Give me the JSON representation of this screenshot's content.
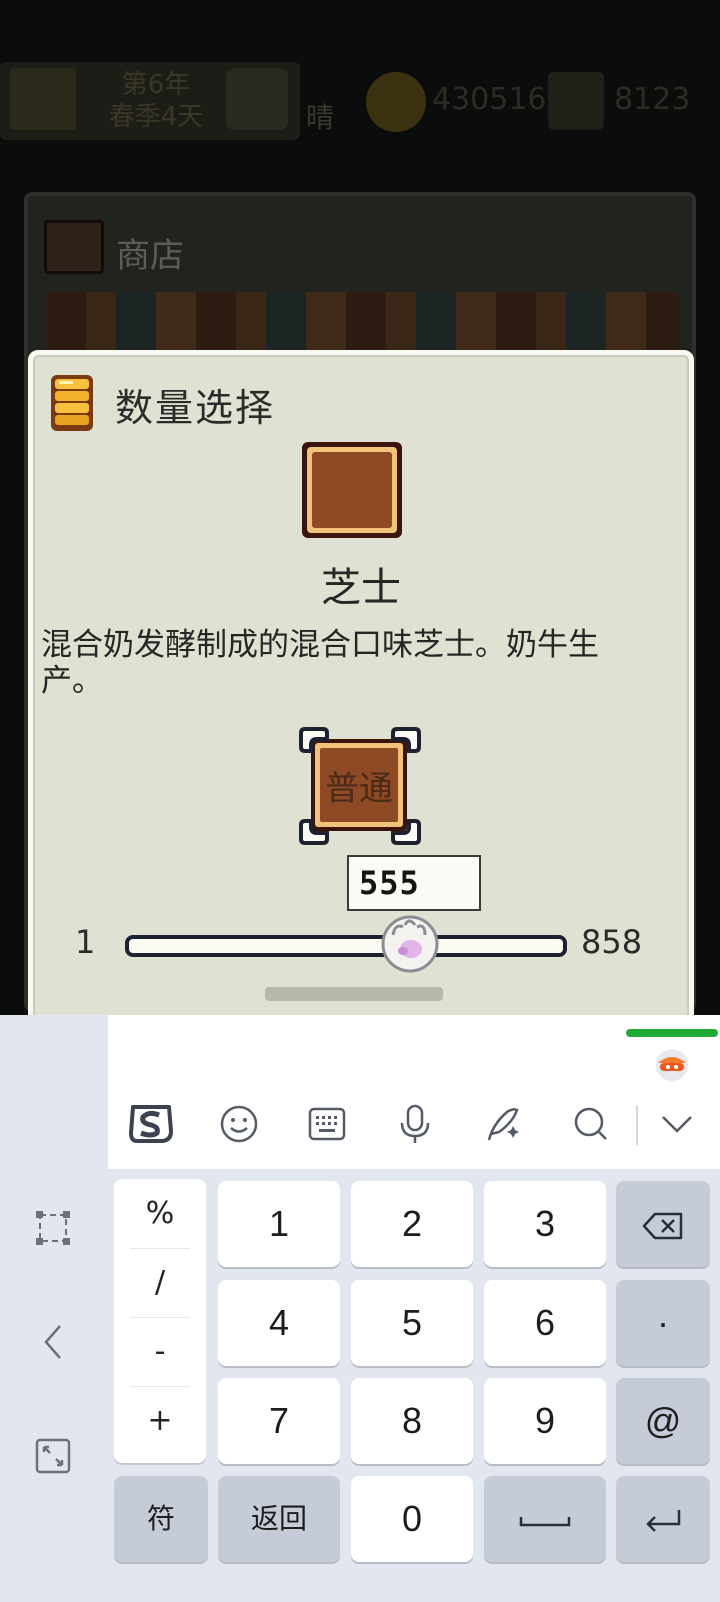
{
  "hud": {
    "date_line1": "第6年",
    "date_line2": "春季4天",
    "weather": "晴",
    "gold": "430516",
    "gems": "8123"
  },
  "shop": {
    "title": "商店"
  },
  "dialog": {
    "title": "数量选择",
    "item_name": "芝士",
    "item_description": "混合奶发酵制成的混合口味芝士。奶牛生产。",
    "quality": "普通",
    "quantity": "555",
    "min": "1",
    "max": "858",
    "slider_fraction": 0.646
  },
  "keyboard": {
    "toolbar": [
      "sogou-logo-icon",
      "emoji-icon",
      "keyboard-icon",
      "microphone-icon",
      "handwriting-icon",
      "search-icon",
      "collapse-icon"
    ],
    "symbols": [
      "%",
      "/",
      "-",
      "+"
    ],
    "rows": [
      [
        "1",
        "2",
        "3"
      ],
      [
        "4",
        "5",
        "6"
      ],
      [
        "7",
        "8",
        "9"
      ]
    ],
    "dot": "·",
    "at": "@",
    "symbols_key": "符",
    "back_key": "返回",
    "zero": "0",
    "colors": {
      "accent_green": "#1faa36",
      "fn_key": "#c5ccd8"
    }
  }
}
